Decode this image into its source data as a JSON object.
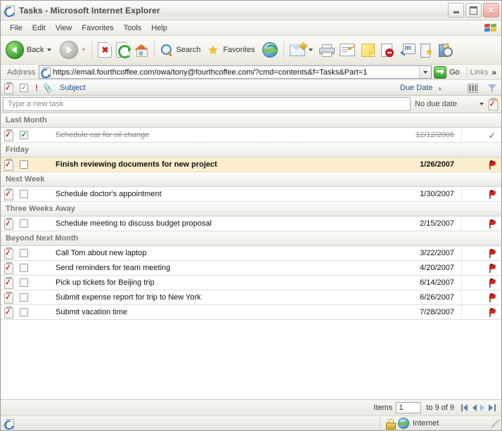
{
  "window": {
    "title": "Tasks - Microsoft Internet Explorer",
    "minimize_label": "Minimize",
    "maximize_label": "Maximize",
    "close_label": "Close"
  },
  "menu": {
    "items": [
      {
        "label": "File"
      },
      {
        "label": "Edit"
      },
      {
        "label": "View"
      },
      {
        "label": "Favorites"
      },
      {
        "label": "Tools"
      },
      {
        "label": "Help"
      }
    ]
  },
  "toolbar": {
    "back_label": "Back",
    "forward_label": "",
    "stop_label": "Stop",
    "refresh_label": "Refresh",
    "home_label": "Home",
    "search_label": "Search",
    "favorites_label": "Favorites",
    "media_label": "Media",
    "mail_label": "Mail",
    "print_label": "Print",
    "edit_label": "Edit",
    "notes_label": "Notes",
    "block_label": "Block",
    "messenger_label": "Messenger",
    "onenote_label": "OneNote",
    "research_label": "Research"
  },
  "address": {
    "label": "Address",
    "url": "https://email.fourthcoffee.com/owa/tony@fourthcoffee.com/?cmd=contents&f=Tasks&Part=1",
    "go_label": "Go",
    "links_label": "Links",
    "expand_label": "»"
  },
  "columns": {
    "subject": "Subject",
    "due_date": "Due Date",
    "sort_indicator": "▲",
    "priority_symbol": "!",
    "attachment_symbol": "ඞ"
  },
  "new_task": {
    "placeholder": "Type a new task",
    "value": "",
    "due_value": "No due date",
    "add_label": "Add task"
  },
  "groups": [
    {
      "label": "Last Month",
      "tasks": [
        {
          "subject": "Schedule car for oil change",
          "due": "12/12/2006",
          "completed": true,
          "selected": false,
          "flag": "check"
        }
      ]
    },
    {
      "label": "Friday",
      "tasks": [
        {
          "subject": "Finish reviewing documents for new project",
          "due": "1/26/2007",
          "completed": false,
          "selected": true,
          "flag": "red"
        }
      ]
    },
    {
      "label": "Next Week",
      "tasks": [
        {
          "subject": "Schedule doctor's appointment",
          "due": "1/30/2007",
          "completed": false,
          "selected": false,
          "flag": "red"
        }
      ]
    },
    {
      "label": "Three Weeks Away",
      "tasks": [
        {
          "subject": "Schedule meeting to discuss budget proposal",
          "due": "2/15/2007",
          "completed": false,
          "selected": false,
          "flag": "red"
        }
      ]
    },
    {
      "label": "Beyond Next Month",
      "tasks": [
        {
          "subject": "Call Tom about new laptop",
          "due": "3/22/2007",
          "completed": false,
          "selected": false,
          "flag": "red"
        },
        {
          "subject": "Send reminders for team meeting",
          "due": "4/20/2007",
          "completed": false,
          "selected": false,
          "flag": "red"
        },
        {
          "subject": "Pick up tickets for Beijing trip",
          "due": "6/14/2007",
          "completed": false,
          "selected": false,
          "flag": "red"
        },
        {
          "subject": "Submit expense report for trip to New York",
          "due": "6/26/2007",
          "completed": false,
          "selected": false,
          "flag": "red"
        },
        {
          "subject": "Submit vacation time",
          "due": "7/28/2007",
          "completed": false,
          "selected": false,
          "flag": "red"
        }
      ]
    }
  ],
  "paging": {
    "items_label": "Items",
    "start_value": "1",
    "range_label": "to 9 of 9",
    "first_label": "First page",
    "prev_label": "Previous page",
    "next_label": "Next page",
    "last_label": "Last page"
  },
  "statusbar": {
    "message": "",
    "zone": "Internet",
    "secure": true
  },
  "colors": {
    "accent": "#25518c",
    "selected_row": "#fbeecd",
    "flag_red": "#cf2424",
    "group_text": "#7a7a72"
  }
}
